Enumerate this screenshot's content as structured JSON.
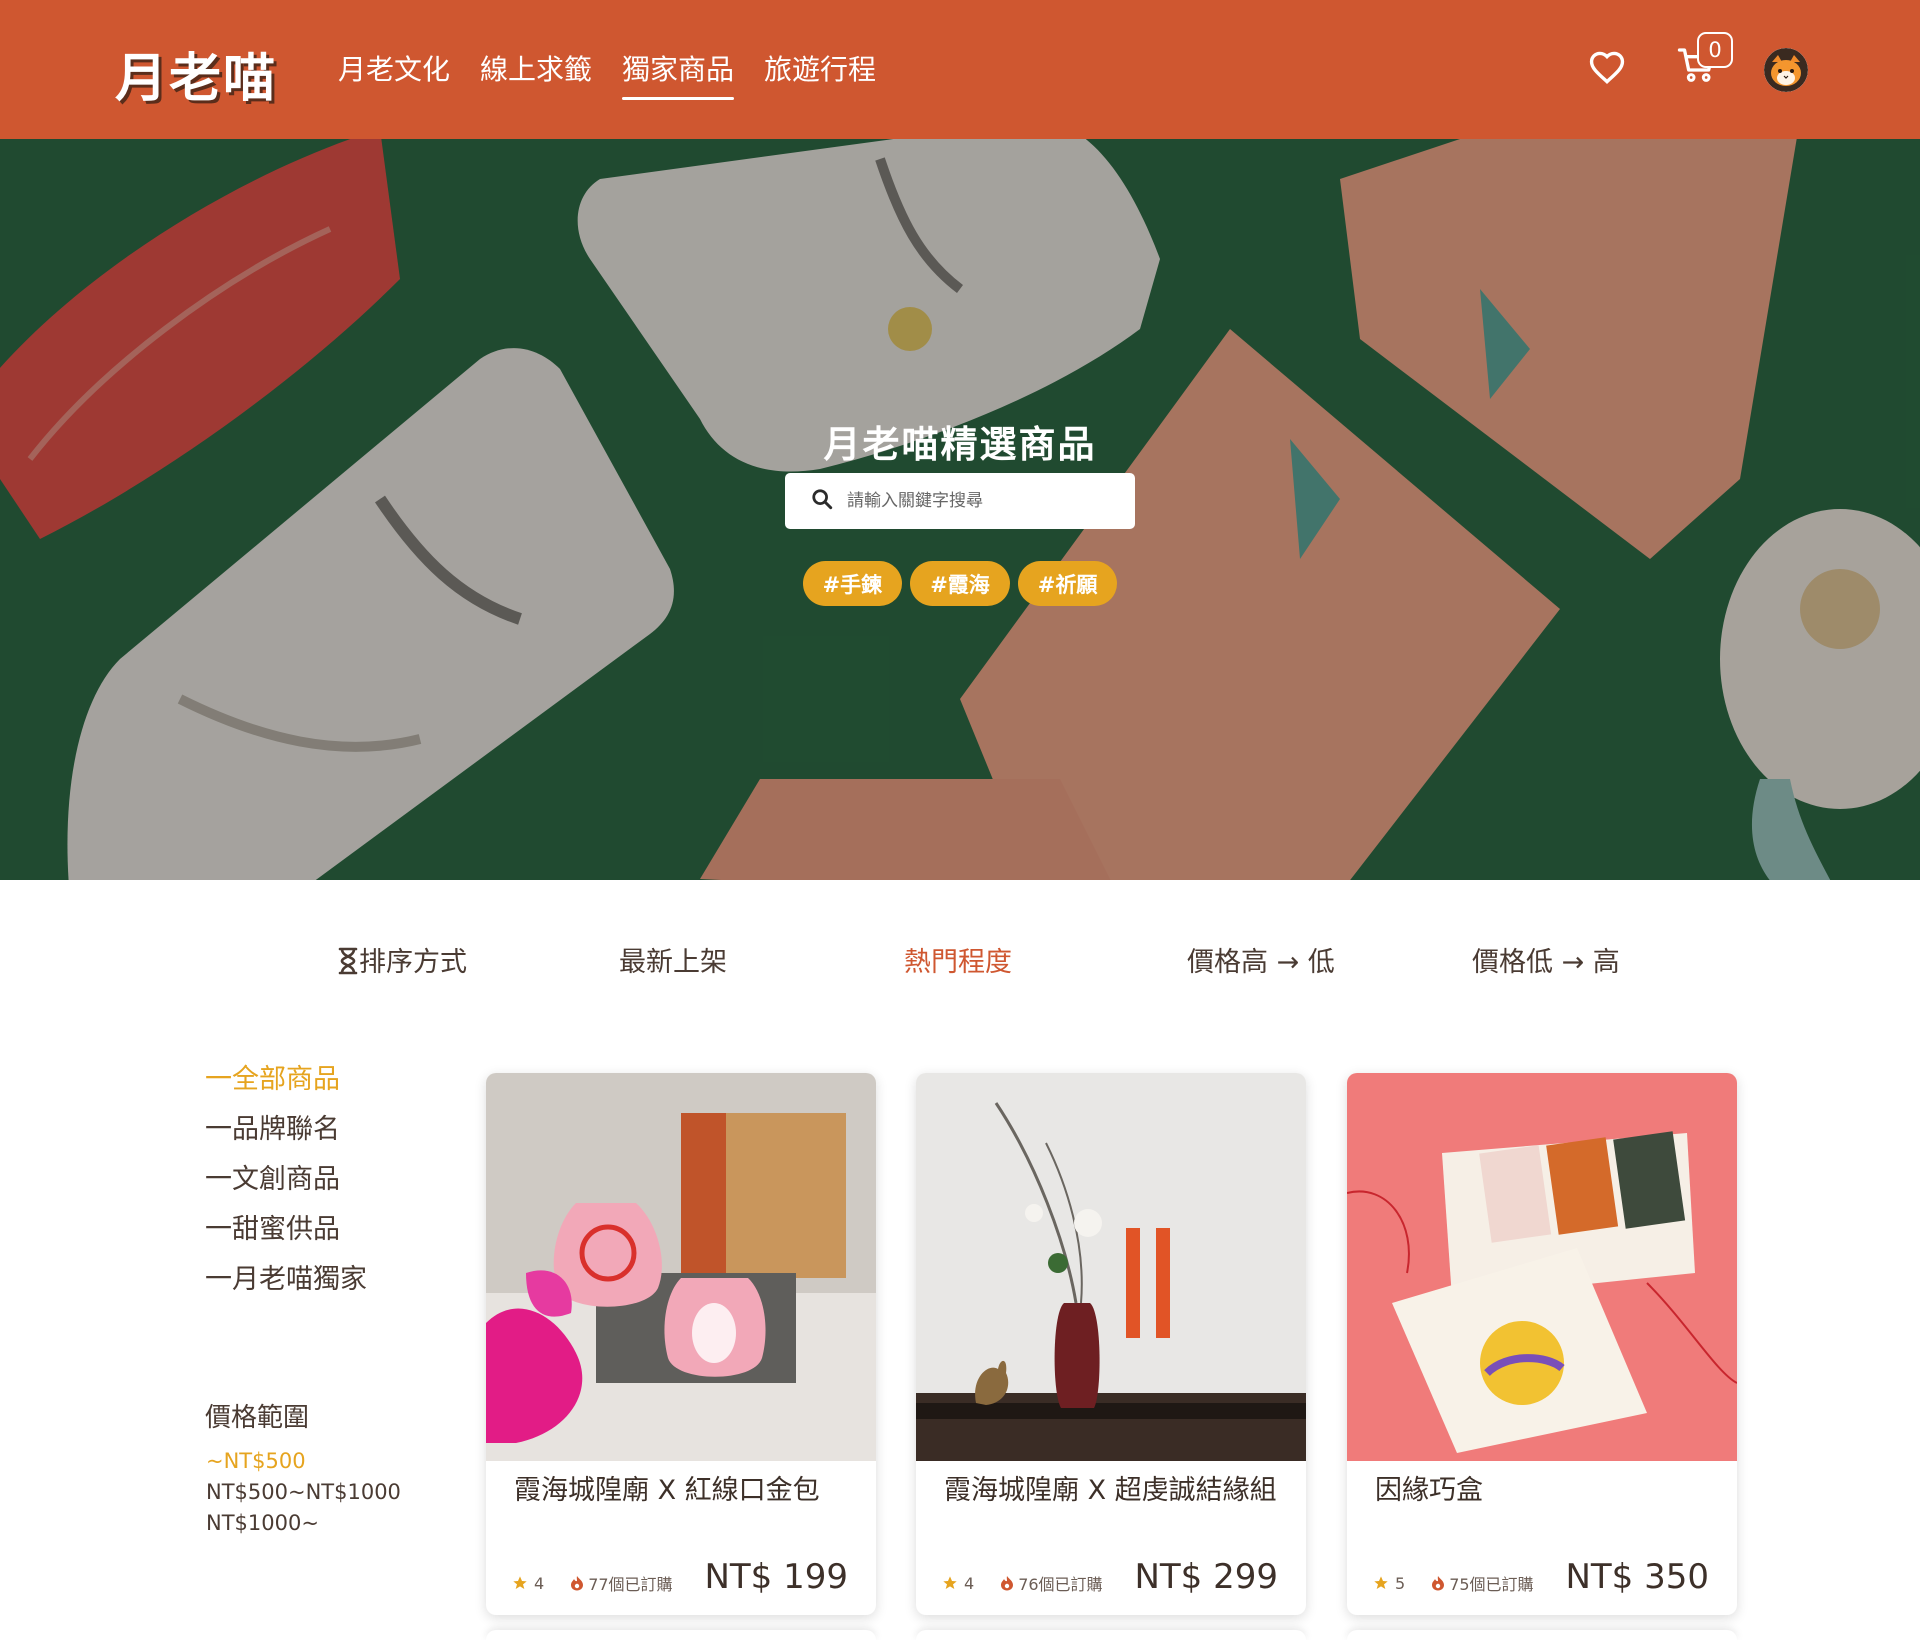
{
  "brand": {
    "logo_text": "月老喵",
    "accent": "#cf5730",
    "highlight": "#e6a41f"
  },
  "nav": {
    "links": [
      {
        "label": "月老文化"
      },
      {
        "label": "線上求籤"
      },
      {
        "label": "獨家商品",
        "active": true
      },
      {
        "label": "旅遊行程"
      }
    ],
    "favorites_icon": "heart-icon",
    "cart_icon": "cart-icon",
    "cart_count": "0",
    "avatar_icon": "cat-avatar-icon"
  },
  "hero": {
    "title": "月老喵精選商品",
    "search_placeholder": "請輸入關鍵字搜尋",
    "search_icon": "search-icon",
    "tags": [
      "#手鍊",
      "#霞海",
      "#祈願"
    ]
  },
  "sort": {
    "label": "排序方式",
    "icon": "hourglass-icon",
    "options": [
      {
        "label": "最新上架"
      },
      {
        "label": "熱門程度",
        "active": true
      },
      {
        "label": "價格高 → 低"
      },
      {
        "label": "價格低 → 高"
      }
    ]
  },
  "sidebar": {
    "categories": [
      {
        "label": "一全部商品",
        "active": true
      },
      {
        "label": "一品牌聯名"
      },
      {
        "label": "一文創商品"
      },
      {
        "label": "一甜蜜供品"
      },
      {
        "label": "一月老喵獨家"
      }
    ],
    "price_title": "價格範圍",
    "price_ranges": [
      {
        "label": "~NT$500",
        "active": true
      },
      {
        "label": "NT$500~NT$1000"
      },
      {
        "label": "NT$1000~"
      }
    ]
  },
  "products": [
    {
      "name": "霞海城隍廟 X 紅線口金包",
      "rating": "4",
      "orders": "77個已訂購",
      "price": "NT$ 199"
    },
    {
      "name": "霞海城隍廟 X 超虔誠結緣組",
      "rating": "4",
      "orders": "76個已訂購",
      "price": "NT$ 299"
    },
    {
      "name": "因緣巧盒",
      "rating": "5",
      "orders": "75個已訂購",
      "price": "NT$ 350"
    }
  ]
}
